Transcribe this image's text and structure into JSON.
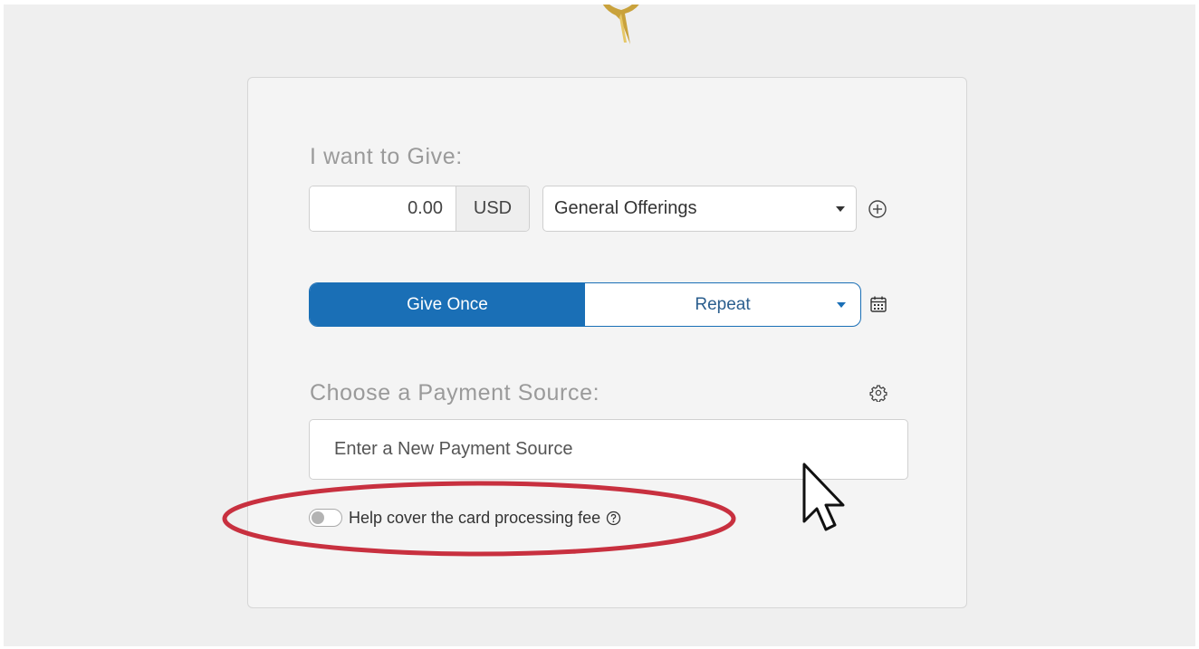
{
  "give": {
    "heading": "I want to Give:",
    "amount_value": "0.00",
    "currency": "USD",
    "fund_selected": "General Offerings"
  },
  "frequency": {
    "once_label": "Give Once",
    "repeat_label": "Repeat",
    "selected": "Give Once"
  },
  "payment": {
    "heading": "Choose a Payment Source:",
    "placeholder": "Enter a New Payment Source"
  },
  "fee": {
    "label": "Help cover the card processing fee",
    "enabled": false
  },
  "icons": {
    "add_fund": "plus-circle-icon",
    "schedule": "calendar-icon",
    "payment_settings": "gear-icon",
    "fee_help": "question-circle-icon",
    "pointer": "mouse-cursor-icon"
  },
  "colors": {
    "primary": "#1a6fb6",
    "highlight": "#c8303f",
    "page_background": "#efefef",
    "card_background": "#f4f4f4"
  }
}
